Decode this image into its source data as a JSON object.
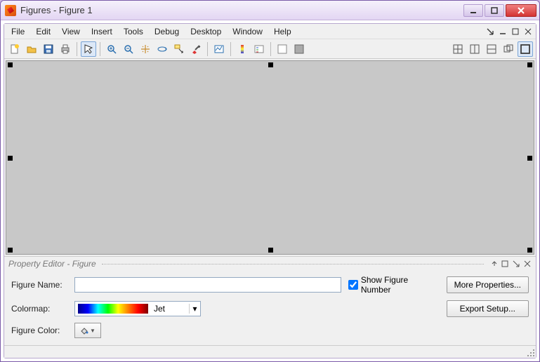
{
  "window": {
    "title": "Figures - Figure 1"
  },
  "menus": {
    "file": "File",
    "edit": "Edit",
    "view": "View",
    "insert": "Insert",
    "tools": "Tools",
    "debug": "Debug",
    "desktop": "Desktop",
    "window": "Window",
    "help": "Help"
  },
  "property_editor": {
    "title": "Property Editor - Figure",
    "figure_name_label": "Figure Name:",
    "figure_name_value": "",
    "show_figure_number_label": "Show Figure Number",
    "show_figure_number_checked": true,
    "colormap_label": "Colormap:",
    "colormap_value": "Jet",
    "figure_color_label": "Figure Color:",
    "more_properties_label": "More Properties...",
    "export_setup_label": "Export Setup..."
  },
  "icons": {
    "new": "new-file-icon",
    "open": "open-folder-icon",
    "save": "save-icon",
    "print": "print-icon",
    "pointer": "pointer-icon",
    "zoomin": "zoom-in-icon",
    "zoomout": "zoom-out-icon",
    "pan": "pan-icon",
    "rotate3d": "rotate-3d-icon",
    "datacursor": "data-cursor-icon",
    "brush": "brush-icon",
    "link": "link-icon",
    "colorbar": "colorbar-icon",
    "legend": "legend-icon",
    "hideplot": "hide-plot-tools-icon",
    "showplot": "show-plot-tools-icon"
  }
}
